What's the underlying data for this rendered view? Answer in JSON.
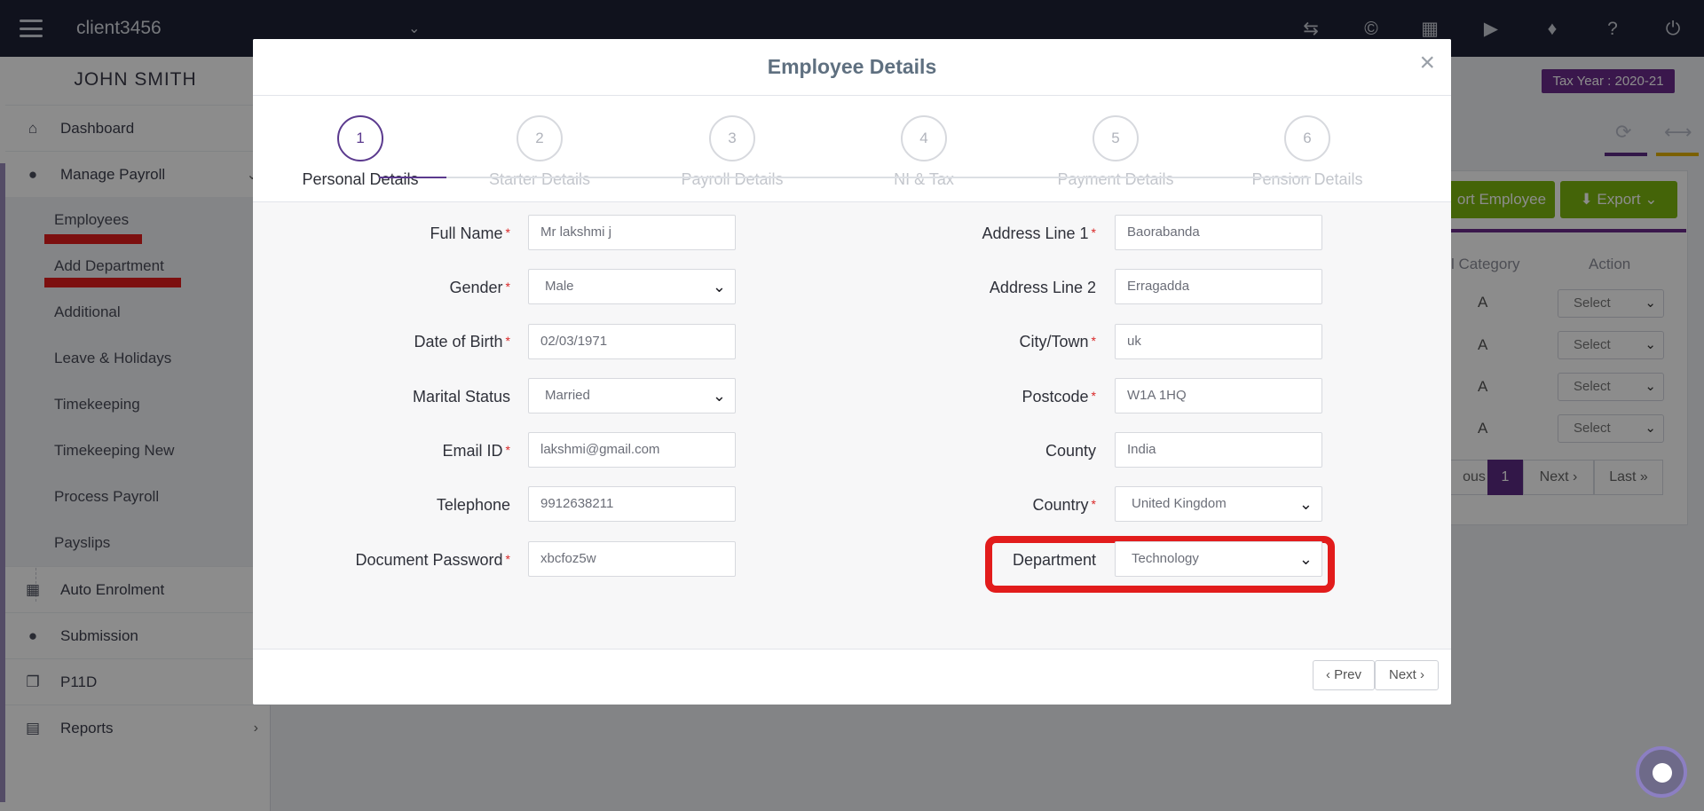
{
  "topbar": {
    "client": "client3456",
    "icons": [
      "swap-icon",
      "copyright-icon",
      "boxes-icon",
      "megaphone-icon",
      "ticket-icon",
      "help-icon",
      "power-icon"
    ]
  },
  "sidebar": {
    "user": "JOHN SMITH",
    "items": [
      {
        "label": "Dashboard",
        "icon": "home-icon"
      },
      {
        "label": "Manage Payroll",
        "icon": "user-icon"
      },
      {
        "label": "Auto Enrolment",
        "icon": "grid-icon"
      },
      {
        "label": "Submission",
        "icon": "users-icon"
      },
      {
        "label": "P11D",
        "icon": "copy-icon"
      },
      {
        "label": "Reports",
        "icon": "report-icon"
      }
    ],
    "subitems": [
      "Employees",
      "Add Department",
      "Additional",
      "Leave & Holidays",
      "Timekeeping",
      "Timekeeping New",
      "Process Payroll",
      "Payslips"
    ]
  },
  "background": {
    "tax_year": "Tax Year : 2020-21",
    "import_btn": "ort Employee",
    "export_btn": "Export",
    "col_category": "l Category",
    "col_action": "Action",
    "row_values": [
      "A",
      "A",
      "A",
      "A"
    ],
    "select_label": "Select",
    "pager": {
      "prev": "ous",
      "current": "1",
      "next": "Next",
      "last": "Last"
    }
  },
  "modal": {
    "title": "Employee Details",
    "steps": [
      {
        "num": "1",
        "label": "Personal Details"
      },
      {
        "num": "2",
        "label": "Starter Details"
      },
      {
        "num": "3",
        "label": "Payroll Details"
      },
      {
        "num": "4",
        "label": "NI & Tax"
      },
      {
        "num": "5",
        "label": "Payment Details"
      },
      {
        "num": "6",
        "label": "Pension Details"
      }
    ],
    "left": {
      "full_name": {
        "label": "Full Name",
        "value": "Mr lakshmi j"
      },
      "gender": {
        "label": "Gender",
        "value": "Male"
      },
      "dob": {
        "label": "Date of Birth",
        "value": "02/03/1971"
      },
      "marital": {
        "label": "Marital Status",
        "value": "Married"
      },
      "email": {
        "label": "Email ID",
        "value": "lakshmi@gmail.com"
      },
      "telephone": {
        "label": "Telephone",
        "value": "9912638211"
      },
      "doc_password": {
        "label": "Document Password",
        "value": "xbcfoz5w"
      }
    },
    "right": {
      "address1": {
        "label": "Address Line 1",
        "value": "Baorabanda"
      },
      "address2": {
        "label": "Address Line 2",
        "value": "Erragadda"
      },
      "city": {
        "label": "City/Town",
        "value": "uk"
      },
      "postcode": {
        "label": "Postcode",
        "value": "W1A 1HQ"
      },
      "county": {
        "label": "County",
        "value": "India"
      },
      "country": {
        "label": "Country",
        "value": "United Kingdom"
      },
      "department": {
        "label": "Department",
        "value": "Technology"
      }
    },
    "footer": {
      "prev": "Prev",
      "next": "Next"
    }
  },
  "colors": {
    "accent": "#5b3a8e",
    "highlight": "#e21c1c",
    "topbar": "#1e2235",
    "export": "#7cb70f"
  }
}
